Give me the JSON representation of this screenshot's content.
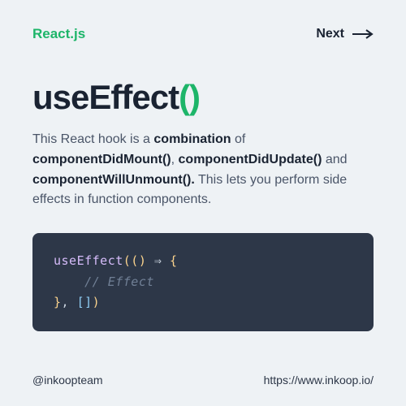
{
  "header": {
    "brand": "React.js",
    "next_label": "Next"
  },
  "title": {
    "name": "useEffect",
    "parens": "()"
  },
  "description": {
    "p1": "This React hook is a ",
    "b1": "combination",
    "p2": " of ",
    "b2": "componentDidMount()",
    "p3": ", ",
    "b3": "componentDidUpdate()",
    "p4": " and ",
    "b4": "componentWillUnmount().",
    "p5": " This lets you perform side effects in function components."
  },
  "code": {
    "fn": "useEffect",
    "open": "(() ",
    "arrow": "⇒",
    "brace_open": " {",
    "comment": "    // Effect",
    "brace_close": "}",
    "comma": ", ",
    "deps": "[]",
    "close": ")"
  },
  "footer": {
    "handle": "@inkoopteam",
    "url": "https://www.inkoop.io/"
  },
  "colors": {
    "accent": "#1db569",
    "bg": "#eef2f5",
    "code_bg": "#2d3748"
  }
}
